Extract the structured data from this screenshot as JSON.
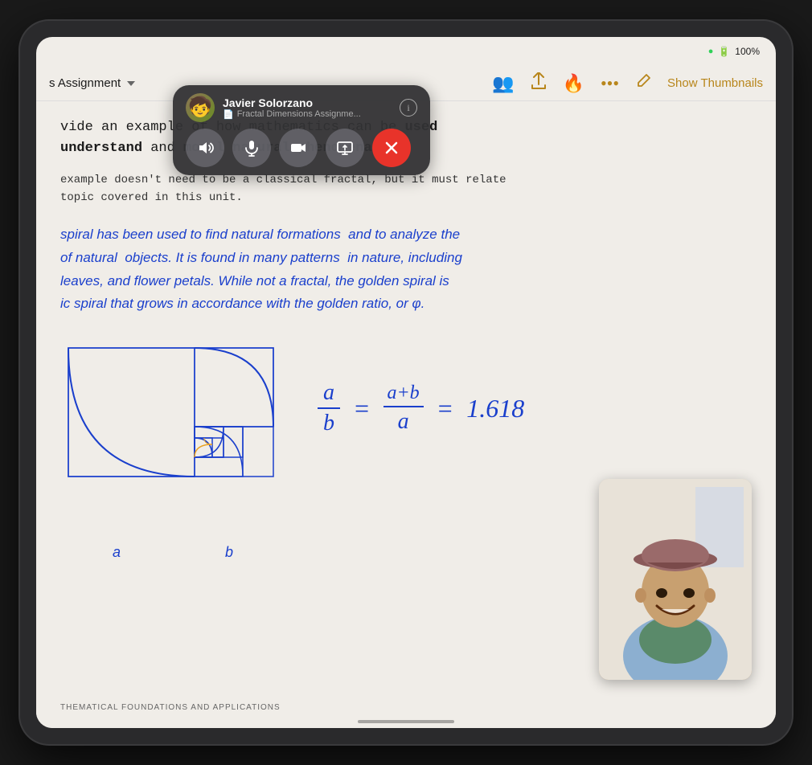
{
  "device": {
    "battery": "100%",
    "wifi": "●",
    "record_indicator": "🎥"
  },
  "toolbar": {
    "title": "s Assignment",
    "show_thumbnails": "Show Thumbnails"
  },
  "toolbar_icons": {
    "collab": "👥",
    "share": "⬆",
    "fire": "🔥",
    "more": "•••",
    "pencil": "✏️"
  },
  "content": {
    "typed_line1": "vide an example of how mathematics can be ",
    "typed_bold1": "used",
    "typed_line2": "understand",
    "typed_and": " and ",
    "typed_bold2": "model natural phenomena",
    "typed_period": ".",
    "subtext1": "example doesn't need to be a classical fractal, but it must relate",
    "subtext2": "topic covered in this unit.",
    "handwritten_line1": "spiral has been used to find natural formations  and to analyze the",
    "handwritten_line2": "of natural  objects. It is found in many patterns  in nature, including",
    "handwritten_line3": "leaves, and flower petals. While not a fractal, the golden spiral is",
    "handwritten_line4": "ic spiral that grows in accordance with the golden ratio, or φ."
  },
  "formula": {
    "fraction1_top": "a",
    "fraction1_bottom": "b",
    "equals1": "=",
    "fraction2_top": "a+b",
    "fraction2_bottom": "a",
    "equals2": "=",
    "value": "1.618"
  },
  "labels": {
    "a": "a",
    "b": "b"
  },
  "footer": {
    "text": "THEMATICAL FOUNDATIONS AND APPLICATIONS"
  },
  "facetime": {
    "caller_name": "Javier Solorzano",
    "document": "Fractal Dimensions Assignme...",
    "avatar_emoji": "🧒",
    "controls": {
      "speaker": "🔊",
      "mic": "🎙",
      "video": "📷",
      "screen": "⊞"
    }
  },
  "icons": {
    "doc": "📄",
    "close": "✕",
    "info": "i"
  }
}
